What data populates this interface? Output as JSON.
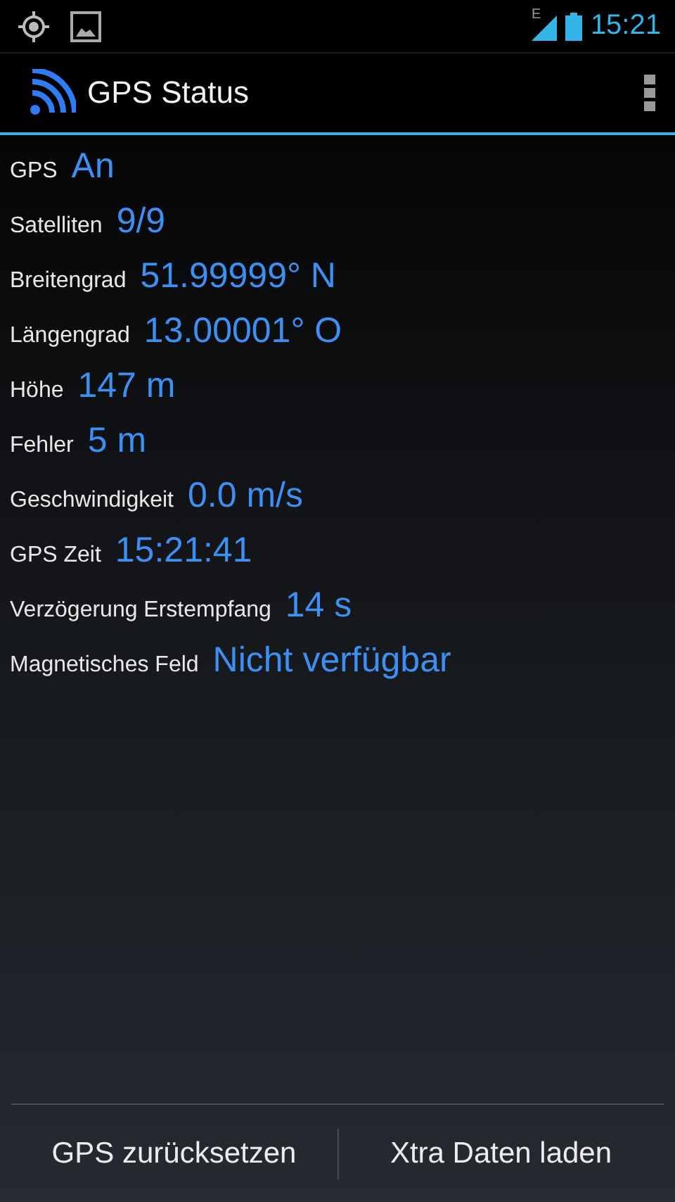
{
  "status_bar": {
    "network": "E",
    "time": "15:21"
  },
  "action_bar": {
    "title": "GPS Status"
  },
  "fields": [
    {
      "label": "GPS",
      "value": "An"
    },
    {
      "label": "Satelliten",
      "value": "9/9"
    },
    {
      "label": "Breitengrad",
      "value": "51.99999° N"
    },
    {
      "label": "Längengrad",
      "value": "13.00001° O"
    },
    {
      "label": "Höhe",
      "value": "147 m"
    },
    {
      "label": "Fehler",
      "value": "5 m"
    },
    {
      "label": "Geschwindigkeit",
      "value": "0.0 m/s"
    },
    {
      "label": "GPS Zeit",
      "value": "15:21:41"
    },
    {
      "label": "Verzögerung Erstempfang",
      "value": "14 s"
    },
    {
      "label": "Magnetisches Feld",
      "value": "Nicht verfügbar"
    }
  ],
  "buttons": [
    "GPS zurücksetzen",
    "Xtra Daten laden"
  ]
}
